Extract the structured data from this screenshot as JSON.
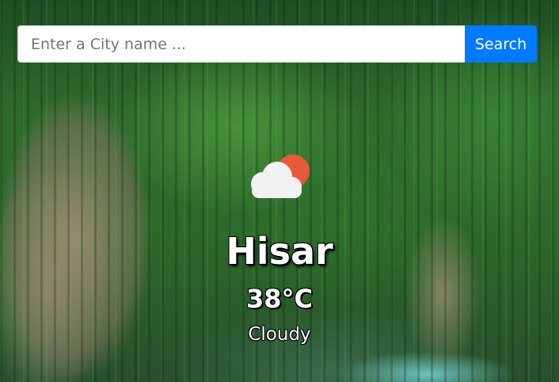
{
  "search": {
    "placeholder": "Enter a City name ...",
    "value": "",
    "button_label": "Search"
  },
  "weather": {
    "icon": "cloud-sun-icon",
    "city": "Hisar",
    "temperature": "38°C",
    "condition": "Cloudy"
  },
  "colors": {
    "accent": "#007bff",
    "sun": "#e8593b",
    "cloud": "#f2f2f2"
  }
}
